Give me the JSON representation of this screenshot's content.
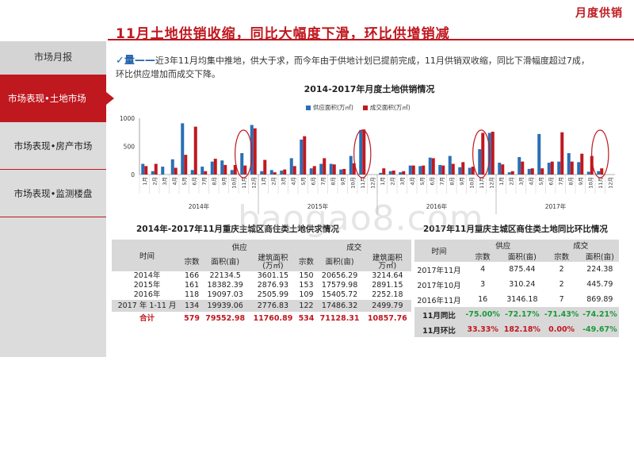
{
  "header": {
    "brand": "月度供销",
    "title": "11月土地供销收缩，同比大幅度下滑，环比供增销减"
  },
  "sidebar": {
    "heading": "市场月报",
    "items": [
      {
        "label": "市场表现•土地市场",
        "active": true
      },
      {
        "label": "市场表现•房产市场",
        "active": false
      },
      {
        "label": "市场表现•监测楼盘",
        "active": false
      }
    ]
  },
  "intro": {
    "lead": "✓量——",
    "text": "近3年11月均集中推地，供大于求，而今年由于供地计划已提前完成，11月供销双收缩，同比下滑幅度超过7成，环比供应增加而成交下降。"
  },
  "chart": {
    "title": "2014-2017年月度土地供销情况",
    "legend_supply": "供应面积(万㎡)",
    "legend_deal": "成交面积(万㎡)",
    "color_supply": "#2a6fb5",
    "color_deal": "#c0181f"
  },
  "chart_data": {
    "type": "bar",
    "title": "2014-2017年月度土地供销情况",
    "ylim": [
      0,
      1000
    ],
    "yticks": [
      0,
      500,
      1000
    ],
    "months": [
      "1月",
      "2月",
      "3月",
      "4月",
      "5月",
      "6月",
      "7月",
      "8月",
      "9月",
      "10月",
      "11月",
      "12月"
    ],
    "years": [
      "2014年",
      "2015年",
      "2016年",
      "2017年"
    ],
    "series": [
      {
        "name": "供应面积(万㎡)",
        "values": [
          [
            190,
            60,
            140,
            270,
            910,
            80,
            140,
            230,
            250,
            80,
            380,
            880
          ],
          [
            60,
            80,
            70,
            290,
            620,
            110,
            190,
            190,
            90,
            330,
            790,
            0
          ],
          [
            30,
            60,
            40,
            160,
            150,
            300,
            170,
            330,
            130,
            120,
            450,
            740
          ],
          [
            210,
            40,
            310,
            100,
            720,
            210,
            230,
            380,
            220,
            50,
            60,
            0
          ]
        ]
      },
      {
        "name": "成交面积(万㎡)",
        "values": [
          [
            150,
            190,
            0,
            120,
            350,
            850,
            60,
            280,
            170,
            170,
            160,
            820
          ],
          [
            260,
            40,
            90,
            150,
            680,
            150,
            290,
            180,
            100,
            200,
            800,
            0
          ],
          [
            110,
            70,
            60,
            160,
            160,
            290,
            160,
            190,
            220,
            140,
            740,
            760
          ],
          [
            180,
            60,
            230,
            110,
            110,
            230,
            750,
            230,
            370,
            330,
            110,
            0
          ]
        ]
      }
    ]
  },
  "table1": {
    "title": "2014年-2017年11月重庆主城区商住类土地供求情况",
    "h_time": "时间",
    "h_supply": "供应",
    "h_deal": "成交",
    "h_count": "宗数",
    "h_area": "面积(亩)",
    "h_build_a": "建筑面积",
    "h_build_b": "(万㎡)",
    "h_build_c": "建筑面积",
    "h_build_d": "万㎡)",
    "rows": [
      [
        "2014年",
        "166",
        "22134.5",
        "3601.15",
        "150",
        "20656.29",
        "3214.64"
      ],
      [
        "2015年",
        "161",
        "18382.39",
        "2876.93",
        "153",
        "17579.98",
        "2891.15"
      ],
      [
        "2016年",
        "118",
        "19097.03",
        "2505.99",
        "109",
        "15405.72",
        "2252.18"
      ]
    ],
    "ytd": [
      "2017 年 1-11 月",
      "134",
      "19939.06",
      "2776.83",
      "122",
      "17486.32",
      "2499.79"
    ],
    "total": [
      "合计",
      "579",
      "79552.98",
      "11760.89",
      "534",
      "71128.31",
      "10857.76"
    ]
  },
  "table2": {
    "title": "2017年11月重庆主城区商住类土地同比环比情况",
    "h_time": "时间",
    "h_supply": "供应",
    "h_deal": "成交",
    "h_count": "宗数",
    "h_area": "面积(亩)",
    "rows": [
      [
        "2017年11月",
        "4",
        "875.44",
        "2",
        "224.38"
      ],
      [
        "2017年10月",
        "3",
        "310.24",
        "2",
        "445.79"
      ],
      [
        "2016年11月",
        "16",
        "3146.18",
        "7",
        "869.89"
      ]
    ],
    "yoy": [
      "11月同比",
      "-75.00%",
      "-72.17%",
      "-71.43%",
      "-74.21%"
    ],
    "mom": [
      "11月环比",
      "33.33%",
      "182.18%",
      "0.00%",
      "-49.67%"
    ]
  },
  "watermark": "baogao8.com"
}
